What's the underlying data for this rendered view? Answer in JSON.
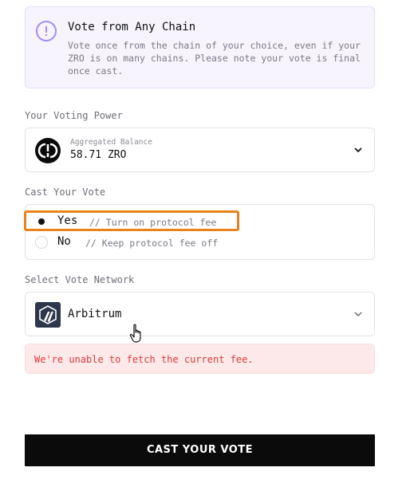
{
  "info": {
    "title": "Vote from Any Chain",
    "text": "Vote once from the chain of your choice, even if your ZRO is on many chains. Please note your vote is final once cast.",
    "icon": "exclamation-circle-icon",
    "accent": "#a78bfa"
  },
  "voting_power": {
    "label": "Your Voting Power",
    "balance_label": "Aggregated Balance",
    "balance_value": "58.71 ZRO",
    "icon": "zro-logo"
  },
  "cast_vote": {
    "label": "Cast Your Vote",
    "options": [
      {
        "label": "Yes",
        "comment": "// Turn on protocol fee",
        "selected": true
      },
      {
        "label": "No",
        "comment": "// Keep protocol fee off",
        "selected": false
      }
    ],
    "highlight_color": "#e8821c"
  },
  "network": {
    "label": "Select Vote Network",
    "selected": "Arbitrum",
    "icon": "arbitrum-logo"
  },
  "error": {
    "text": "We're unable to fetch the current fee.",
    "color": "#dc3b3b"
  },
  "submit": {
    "label": "CAST YOUR VOTE"
  }
}
